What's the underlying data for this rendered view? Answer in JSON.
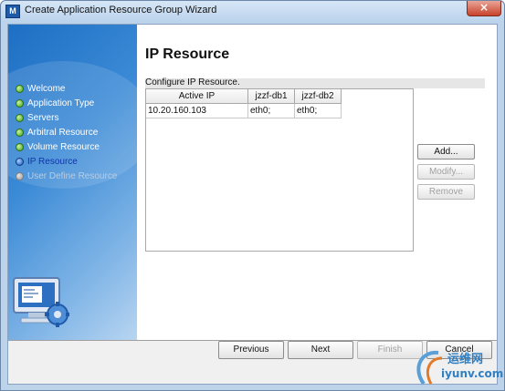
{
  "window": {
    "title": "Create Application Resource Group Wizard",
    "app_icon_glyph": "M",
    "close_glyph": "×"
  },
  "steps": [
    {
      "label": "Welcome",
      "state": "done"
    },
    {
      "label": "Application Type",
      "state": "done"
    },
    {
      "label": "Servers",
      "state": "done"
    },
    {
      "label": "Arbitral Resource",
      "state": "done"
    },
    {
      "label": "Volume Resource",
      "state": "done"
    },
    {
      "label": "IP Resource",
      "state": "current"
    },
    {
      "label": "User Define Resource",
      "state": "todo"
    }
  ],
  "page": {
    "title": "IP Resource",
    "section_label": "Configure IP Resource."
  },
  "table": {
    "columns": [
      "Active IP",
      "jzzf-db1",
      "jzzf-db2"
    ],
    "rows": [
      [
        "10.20.160.103",
        "eth0;",
        "eth0;"
      ]
    ]
  },
  "side_buttons": {
    "add": "Add...",
    "modify": "Modify...",
    "remove": "Remove"
  },
  "nav_buttons": {
    "previous": "Previous",
    "next": "Next",
    "finish": "Finish",
    "cancel": "Cancel"
  },
  "watermark": {
    "cn": "运维网",
    "en": "iyunv.com"
  },
  "colors": {
    "sidebar_top": "#1d6fc4",
    "step_done": "#3fa016",
    "step_current": "#1454b8",
    "step_todo": "#9a9a9a",
    "close_button": "#c8422c"
  },
  "icons": {
    "app": "app-logo-icon",
    "close": "close-icon",
    "sidebar_art": "computer-gear-icon"
  }
}
